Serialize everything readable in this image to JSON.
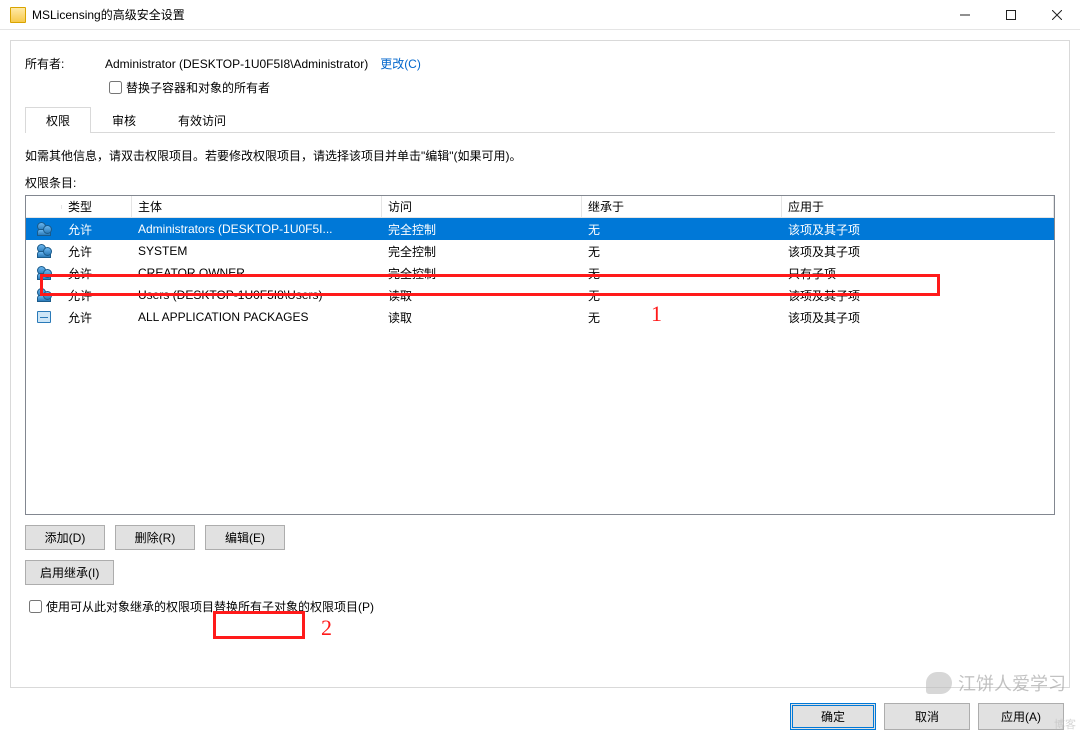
{
  "window": {
    "title": "MSLicensing的高级安全设置"
  },
  "owner": {
    "label": "所有者:",
    "value": "Administrator (DESKTOP-1U0F5I8\\Administrator)",
    "change_link": "更改(C)",
    "replace_children_label": "替换子容器和对象的所有者"
  },
  "tabs": {
    "permissions": "权限",
    "auditing": "审核",
    "effective_access": "有效访问"
  },
  "instructions": "如需其他信息，请双击权限项目。若要修改权限项目，请选择该项目并单击\"编辑\"(如果可用)。",
  "entries_label": "权限条目:",
  "columns": {
    "type": "类型",
    "principal": "主体",
    "access": "访问",
    "inherited_from": "继承于",
    "applies_to": "应用于"
  },
  "rows": [
    {
      "icon": "users",
      "type": "允许",
      "principal": "Administrators (DESKTOP-1U0F5I...",
      "access": "完全控制",
      "inherited": "无",
      "applies": "该项及其子项",
      "selected": true
    },
    {
      "icon": "users",
      "type": "允许",
      "principal": "SYSTEM",
      "access": "完全控制",
      "inherited": "无",
      "applies": "该项及其子项",
      "selected": false
    },
    {
      "icon": "users",
      "type": "允许",
      "principal": "CREATOR OWNER",
      "access": "完全控制",
      "inherited": "无",
      "applies": "只有子项",
      "selected": false
    },
    {
      "icon": "users",
      "type": "允许",
      "principal": "Users (DESKTOP-1U0F5I8\\Users)",
      "access": "读取",
      "inherited": "无",
      "applies": "该项及其子项",
      "selected": false
    },
    {
      "icon": "pkg",
      "type": "允许",
      "principal": "ALL APPLICATION PACKAGES",
      "access": "读取",
      "inherited": "无",
      "applies": "该项及其子项",
      "selected": false
    }
  ],
  "buttons": {
    "add": "添加(D)",
    "remove": "删除(R)",
    "edit": "编辑(E)",
    "enable_inherit": "启用继承(I)"
  },
  "replace_child_perm_label": "使用可从此对象继承的权限项目替换所有子对象的权限项目(P)",
  "bottom": {
    "ok": "确定",
    "cancel": "取消",
    "apply": "应用(A)"
  },
  "annotations": {
    "one": "1",
    "two": "2"
  },
  "watermark": "江饼人爱学习",
  "corner_watermark": "博客"
}
